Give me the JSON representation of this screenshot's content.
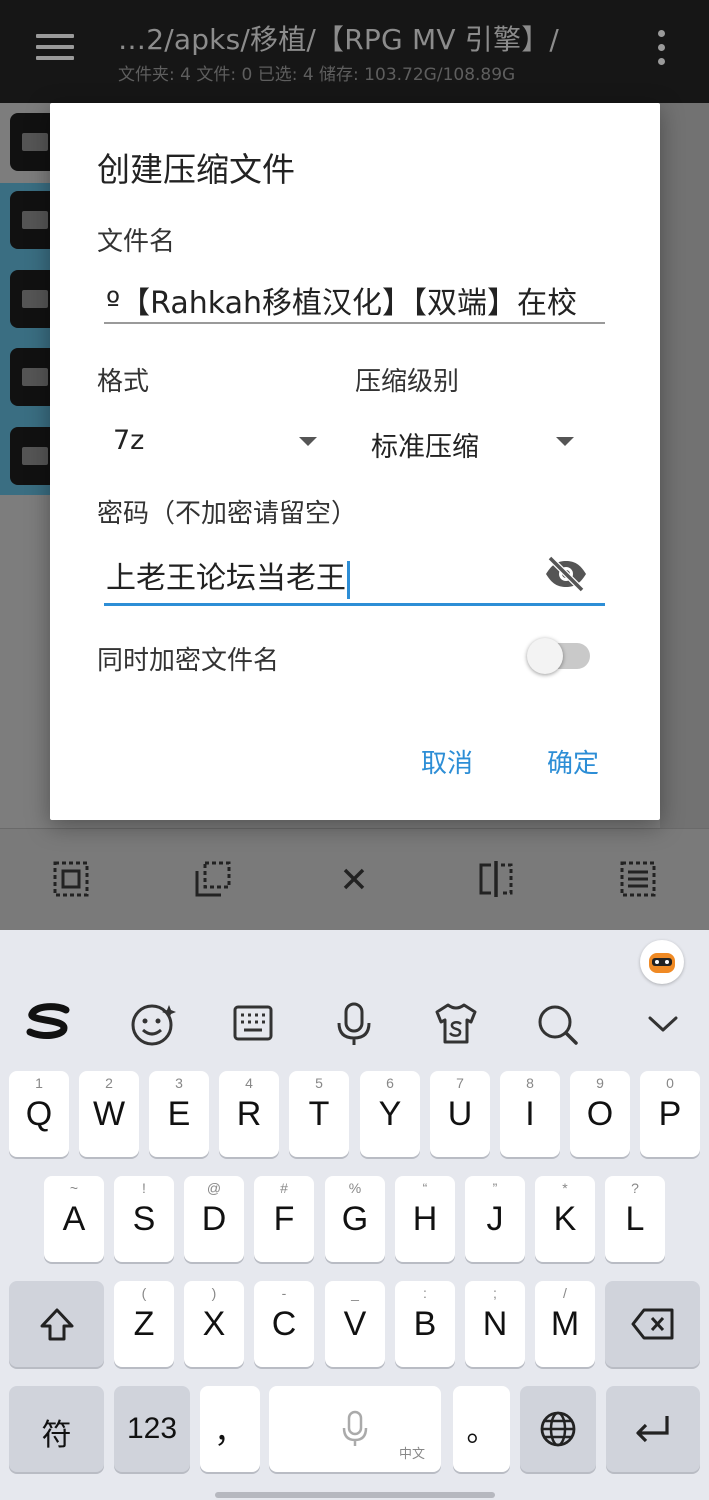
{
  "appbar": {
    "path": "…2/apks/移植/【RPG MV 引擎】/",
    "stats": "文件夹: 4  文件: 0  已选: 4  储存: 103.72G/108.89G"
  },
  "dialog": {
    "title": "创建压缩文件",
    "filename_label": "文件名",
    "filename_value": "º【Rahkah移植汉化】【双端】在校",
    "format_label": "格式",
    "format_value": "7z",
    "level_label": "压缩级别",
    "level_value": "标准压缩",
    "password_label": "密码（不加密请留空）",
    "password_value": "上老王论坛当老王",
    "encrypt_names_label": "同时加密文件名",
    "encrypt_names_on": false,
    "cancel_label": "取消",
    "ok_label": "确定"
  },
  "keyboard": {
    "row1": [
      {
        "main": "Q",
        "sub": "1"
      },
      {
        "main": "W",
        "sub": "2"
      },
      {
        "main": "E",
        "sub": "3"
      },
      {
        "main": "R",
        "sub": "4"
      },
      {
        "main": "T",
        "sub": "5"
      },
      {
        "main": "Y",
        "sub": "6"
      },
      {
        "main": "U",
        "sub": "7"
      },
      {
        "main": "I",
        "sub": "8"
      },
      {
        "main": "O",
        "sub": "9"
      },
      {
        "main": "P",
        "sub": "0"
      }
    ],
    "row2": [
      {
        "main": "A",
        "sub": "~"
      },
      {
        "main": "S",
        "sub": "!"
      },
      {
        "main": "D",
        "sub": "@"
      },
      {
        "main": "F",
        "sub": "#"
      },
      {
        "main": "G",
        "sub": "%"
      },
      {
        "main": "H",
        "sub": "“"
      },
      {
        "main": "J",
        "sub": "”"
      },
      {
        "main": "K",
        "sub": "*"
      },
      {
        "main": "L",
        "sub": "?"
      }
    ],
    "row3": [
      {
        "main": "Z",
        "sub": "("
      },
      {
        "main": "X",
        "sub": ")"
      },
      {
        "main": "C",
        "sub": "-"
      },
      {
        "main": "V",
        "sub": "_"
      },
      {
        "main": "B",
        "sub": ":"
      },
      {
        "main": "N",
        "sub": ";"
      },
      {
        "main": "M",
        "sub": "/"
      }
    ],
    "symbols_label": "符",
    "numbers_label": "123",
    "comma_label": "，",
    "period_label": "。",
    "space_lang_label": "中文"
  }
}
